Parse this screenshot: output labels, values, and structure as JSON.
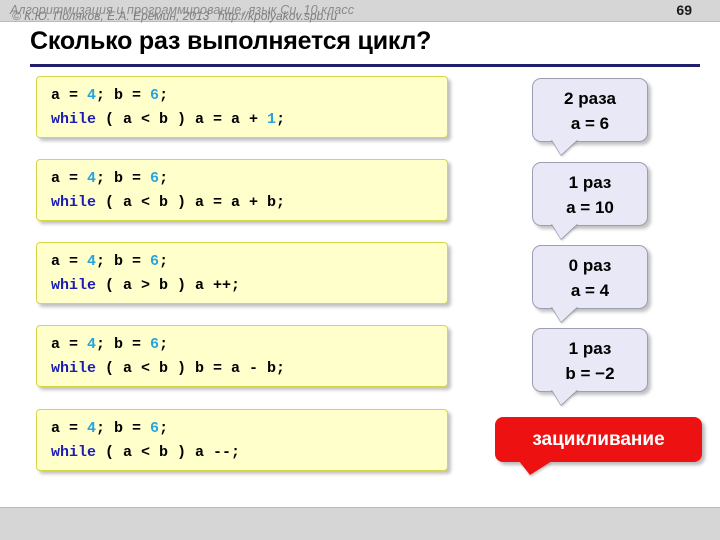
{
  "header": {
    "title": "Алгоритмизация и программирование, язык Си, 10 класс",
    "page_number": "69"
  },
  "slide": {
    "title": "Сколько раз выполняется цикл?"
  },
  "code_blocks": [
    {
      "line1_pre": "a = ",
      "line1_num1": "4",
      "line1_mid": "; b = ",
      "line1_num2": "6",
      "line1_post": ";",
      "line2_kw": "while",
      "line2_rest_pre": " ( a < b ) a = a + ",
      "line2_num": "1",
      "line2_post": ";"
    },
    {
      "line1_pre": "a = ",
      "line1_num1": "4",
      "line1_mid": "; b = ",
      "line1_num2": "6",
      "line1_post": ";",
      "line2_kw": "while",
      "line2_rest_pre": " ( a < b ) a = a + b;",
      "line2_num": "",
      "line2_post": ""
    },
    {
      "line1_pre": "a = ",
      "line1_num1": "4",
      "line1_mid": "; b = ",
      "line1_num2": "6",
      "line1_post": ";",
      "line2_kw": "while",
      "line2_rest_pre": " ( a > b ) a ++;",
      "line2_num": "",
      "line2_post": ""
    },
    {
      "line1_pre": "a = ",
      "line1_num1": "4",
      "line1_mid": "; b = ",
      "line1_num2": "6",
      "line1_post": ";",
      "line2_kw": "while",
      "line2_rest_pre": " ( a < b ) b = a - b;",
      "line2_num": "",
      "line2_post": ""
    },
    {
      "line1_pre": "a = ",
      "line1_num1": "4",
      "line1_mid": "; b = ",
      "line1_num2": "6",
      "line1_post": ";",
      "line2_kw": "while",
      "line2_rest_pre": " ( a < b ) a --;",
      "line2_num": "",
      "line2_post": ""
    }
  ],
  "callouts": [
    {
      "count": "2 раза",
      "result": "a = 6"
    },
    {
      "count": "1 раз",
      "result": "a = 10"
    },
    {
      "count": "0 раз",
      "result": "a = 4"
    },
    {
      "count": "1 раз",
      "result": "b = −2"
    }
  ],
  "loop_callout": {
    "label": "зацикливание",
    "color": "#ee1111"
  },
  "footer": {
    "copyright": "© К.Ю. Поляков, Е.А. Ерёмин, 2013",
    "url": "http://kpolyakov.spb.ru"
  },
  "colors": {
    "header_bar": "#d6d6d6",
    "title_rule": "#1f1f6e",
    "code_bg": "#ffffcc",
    "code_border": "#d6d64a",
    "keyword": "#1c1cb4",
    "number": "#29a3e0",
    "callout_bg": "#e8e8f6",
    "callout_border": "#9d9db4",
    "loop_red": "#ee1111"
  }
}
